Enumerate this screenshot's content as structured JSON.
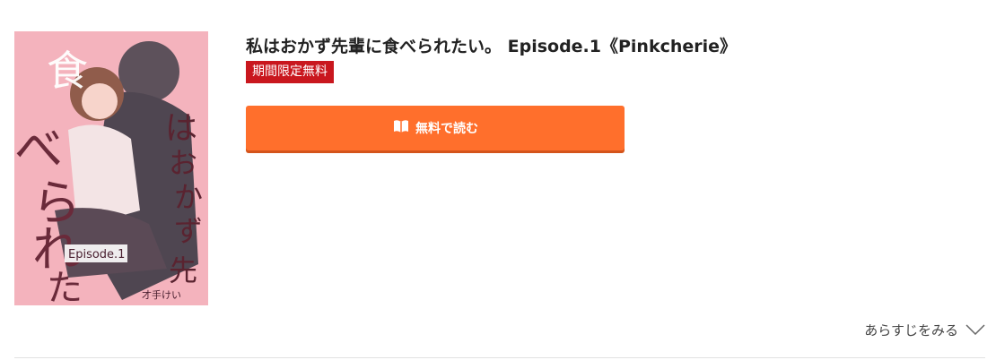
{
  "cover": {
    "title_text": "私はおかず先輩に食べられたい。",
    "episode_text": "Episode.1",
    "author_text": "才手けい",
    "background_color": "#f4b4bd"
  },
  "title": "私はおかず先輩に食べられたい。 Episode.1《Pinkcherie》",
  "badge": "期間限定無料",
  "read_button": {
    "label": "無料で読む",
    "icon": "book-icon",
    "color": "#ff6f2c"
  },
  "synopsis_link": {
    "label": "あらすじをみる",
    "icon": "chevron-down-icon"
  }
}
